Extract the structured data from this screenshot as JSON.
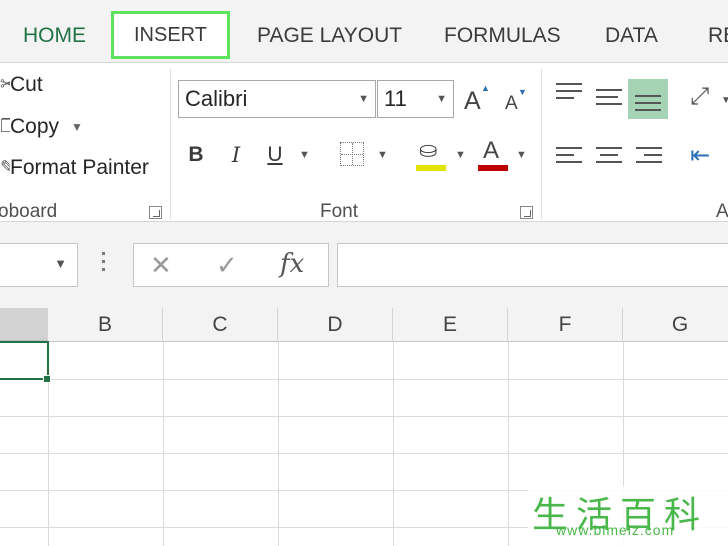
{
  "ribbon_tabs": {
    "home": "HOME",
    "insert": "INSERT",
    "page_layout": "PAGE LAYOUT",
    "formulas": "FORMULAS",
    "data": "DATA",
    "review": "RE"
  },
  "clipboard": {
    "cut": "Cut",
    "copy": "Copy",
    "format_painter": "Format Painter",
    "group_label": "oboard"
  },
  "font": {
    "font_name": "Calibri",
    "font_size": "11",
    "grow_label": "A",
    "shrink_label": "A",
    "bold": "B",
    "italic": "I",
    "underline": "U",
    "font_color_label": "A",
    "group_label": "Font",
    "fill_color": "#e3e300",
    "font_color": "#c00000"
  },
  "alignment": {
    "group_label": "A"
  },
  "formula_bar": {
    "fx_label": "fx",
    "cancel_glyph": "✕",
    "enter_glyph": "✓"
  },
  "columns": [
    "B",
    "C",
    "D",
    "E",
    "F",
    "G"
  ],
  "watermark": {
    "chars": "生活百科",
    "url": "www.bimeiz.com"
  }
}
